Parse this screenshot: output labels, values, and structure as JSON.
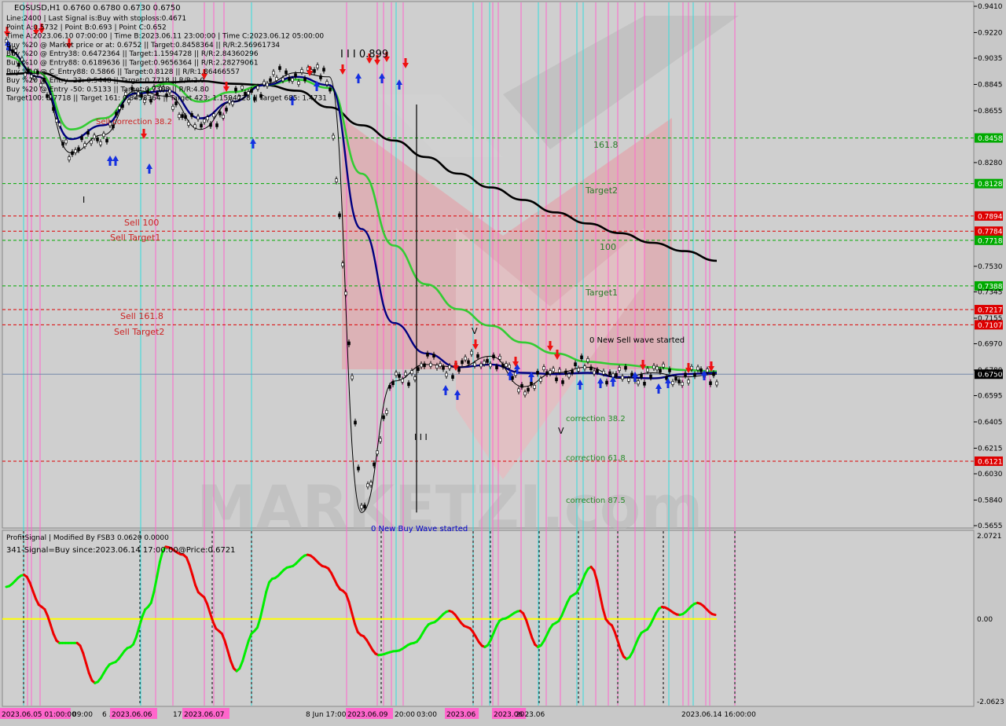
{
  "header": {
    "symbol_line": "EOSUSD,H1  0.6760  0.6780  0.6730  0.6750",
    "info_lines": [
      "Line:2400  |  Last Signal is:Buy with stoploss:0.4671",
      "Point A:0.5732  |  Point B:0.693  |  Point C:0.652",
      "Time A:2023.06.10 07:00:00  |  Time B:2023.06.11 23:00:00  |  Time C:2023.06.12 05:00:00",
      "Buy %20 @ Market price or at: 0.6752  ||  Target:0.8458364  ||  R/R:2.56961734",
      "Buy %20 @ Entry38: 0.6472364  ||  Target:1.1594728  ||  R/R:2.84360296",
      "Buy %10 @ Entry88: 0.6189636  ||  Target:0.9656364  ||  R/R:2.28279061",
      "Buy %10 @ C_Entry88: 0.5866  ||  Target:0.8128  ||  R/R:1.86466557",
      "Buy %20 @ Entry -23: 0.5448  ||  Target:0.7718  ||  R/R:2.0",
      "Buy %20 @ Entry -50: 0.5133  ||  Target:0.7388  ||  R/R:4.80",
      "Target100: 0.7718  ||  Target 161: 0.8458364  ||  Target 423: 1.1594728  ||  Target 685: 1.4731"
    ]
  },
  "colors": {
    "background": "#c8c8c8",
    "buy_level": "#00aa00",
    "sell_level": "#dd0000",
    "ma_slow": "#000000",
    "ma_mid": "#33cc33",
    "ma_fast": "#000080",
    "magenta_vline": "#ff66cc",
    "cyan_vline": "#33dddd",
    "osc_up": "#00ee00",
    "osc_down": "#ee0000",
    "zero_line": "#ffff00"
  },
  "price_levels": [
    {
      "price": 0.8458,
      "label": "0.8458",
      "kind": "buy"
    },
    {
      "price": 0.8128,
      "label": "0.8128",
      "kind": "buy"
    },
    {
      "price": 0.7894,
      "label": "0.7894",
      "kind": "sell"
    },
    {
      "price": 0.7784,
      "label": "0.7784",
      "kind": "sell"
    },
    {
      "price": 0.7718,
      "label": "0.7718",
      "kind": "buy"
    },
    {
      "price": 0.7388,
      "label": "0.7388",
      "kind": "buy"
    },
    {
      "price": 0.7217,
      "label": "0.7217",
      "kind": "sell"
    },
    {
      "price": 0.7107,
      "label": "0.7107",
      "kind": "sell"
    },
    {
      "price": 0.6121,
      "label": "0.6121",
      "kind": "sell"
    }
  ],
  "current_price": {
    "price": 0.675,
    "label": "0.6750"
  },
  "chart_labels": {
    "peak": "I I I 0.899",
    "sell_correction": "Sell correction 38.2",
    "sell_100": "Sell 100",
    "sell_target1": "Sell Target1",
    "sell_1618": "Sell 161.8",
    "sell_target2": "Sell Target2",
    "buy_1618": "161.8",
    "target2": "Target2",
    "buy_100": "100",
    "target1": "Target1",
    "new_sell_wave": "0 New Sell wave started",
    "correction_382": "correction 38.2",
    "correction_618": "correction 61.8",
    "correction_875": "correction 87.5",
    "new_buy_wave": "0 New Buy Wave started",
    "mark_v1": "V",
    "mark_v2": "V",
    "mark_i": "I",
    "mark_iii": "I I I"
  },
  "indicator": {
    "title": "ProfitSignal  |  Modified By FSB3 0.0620 0.0000",
    "signal": "341-Signal=Buy since:2023.06.14 17:00:00@Price:0.6721",
    "axis_labels": [
      "2.0721",
      "0.00",
      "-2.0623"
    ]
  },
  "time_axis_labels": [
    "2023.06.05 01:00:00",
    "09:00",
    "6 ...",
    "2023.06.06",
    "17:...",
    "2023.06.07",
    "8 Jun 17:00",
    "2023.06.09",
    "20:00",
    "03:00",
    "2023.06",
    "2023.06",
    "2023.06",
    "2023.06.14 16:00:00"
  ],
  "chart_data": [
    {
      "type": "line",
      "title": "EOSUSD,H1",
      "xlabel": "",
      "ylabel": "",
      "ylim": [
        0.5655,
        0.941
      ],
      "y_ticks": [
        "0.9410",
        "0.9220",
        "0.9035",
        "0.8845",
        "0.8655",
        "0.8458",
        "0.8280",
        "0.8128",
        "0.7894",
        "0.7784",
        "0.7718",
        "0.7530",
        "0.7388",
        "0.7345",
        "0.7217",
        "0.7155",
        "0.7107",
        "0.6970",
        "0.6780",
        "0.6750",
        "0.6595",
        "0.6405",
        "0.6215",
        "0.6121",
        "0.6030",
        "0.5840",
        "0.5655"
      ],
      "series": [
        {
          "values": [
            0.892,
            0.893,
            0.887,
            0.888,
            0.886,
            0.886,
            0.887,
            0.885,
            0.884,
            0.88,
            0.868,
            0.855,
            0.844,
            0.832,
            0.82,
            0.81,
            0.801,
            0.792,
            0.784,
            0.777,
            0.77,
            0.764,
            0.757
          ]
        },
        {
          "values": [
            0.905,
            0.893,
            0.852,
            0.86,
            0.878,
            0.885,
            0.872,
            0.879,
            0.884,
            0.888,
            0.882,
            0.82,
            0.768,
            0.74,
            0.722,
            0.71,
            0.698,
            0.69,
            0.684,
            0.682,
            0.68,
            0.678,
            0.677
          ]
        },
        {
          "values": [
            0.91,
            0.89,
            0.845,
            0.855,
            0.878,
            0.88,
            0.86,
            0.872,
            0.884,
            0.89,
            0.884,
            0.78,
            0.712,
            0.69,
            0.68,
            0.682,
            0.676,
            0.675,
            0.676,
            0.673,
            0.672,
            0.675,
            0.676
          ]
        },
        {
          "values": [
            0.91,
            0.89,
            0.835,
            0.848,
            0.88,
            0.876,
            0.852,
            0.872,
            0.885,
            0.893,
            0.89,
            0.575,
            0.67,
            0.682,
            0.68,
            0.688,
            0.666,
            0.676,
            0.68,
            0.672,
            0.676,
            0.673,
            0.675
          ]
        }
      ]
    },
    {
      "type": "line",
      "title": "ProfitSignal",
      "xlabel": "",
      "ylabel": "",
      "ylim": [
        -2.0623,
        2.0721
      ],
      "series": [
        {
          "values": [
            0.8,
            1.1,
            0.3,
            -0.6,
            -0.6,
            -1.6,
            -1.1,
            -0.7,
            0.3,
            1.8,
            1.6,
            0.6,
            -0.3,
            -1.3,
            -0.3,
            1.0,
            1.3,
            1.6,
            1.3,
            0.7,
            -0.4,
            -0.9,
            -0.8,
            -0.6,
            -0.1,
            0.2,
            -0.2,
            -0.7,
            0.0,
            0.2,
            -0.7,
            -0.1,
            0.6,
            1.3,
            -0.1,
            -1.0,
            -0.3,
            0.3,
            0.1,
            0.4,
            0.1
          ]
        }
      ]
    }
  ]
}
